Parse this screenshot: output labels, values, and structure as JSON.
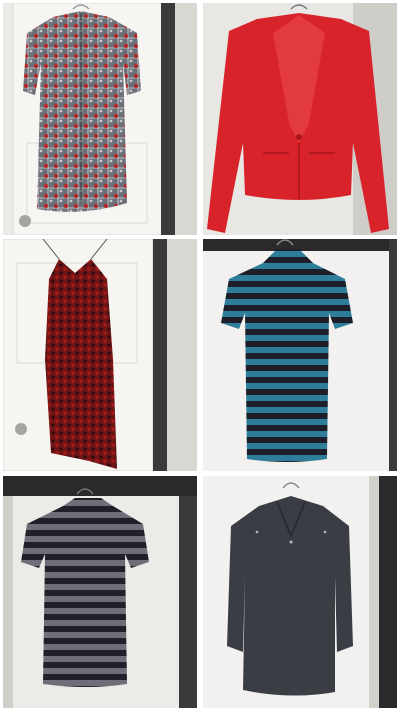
{
  "collage": {
    "items": [
      {
        "name": "floral-shirt-dress",
        "color": "#6b6f78",
        "accent": "#b02a2a"
      },
      {
        "name": "red-blazer",
        "color": "#d8232a",
        "accent": "#a8141a"
      },
      {
        "name": "red-lace-slip-dress",
        "color": "#6e1414",
        "accent": "#2a0a0a"
      },
      {
        "name": "teal-striped-top",
        "color": "#2e7d9a",
        "accent": "#1c1f2a"
      },
      {
        "name": "gray-striped-top",
        "color": "#6e6e78",
        "accent": "#1f2029"
      },
      {
        "name": "charcoal-blouse",
        "color": "#3a3d44",
        "accent": "#2a2c31"
      }
    ]
  }
}
